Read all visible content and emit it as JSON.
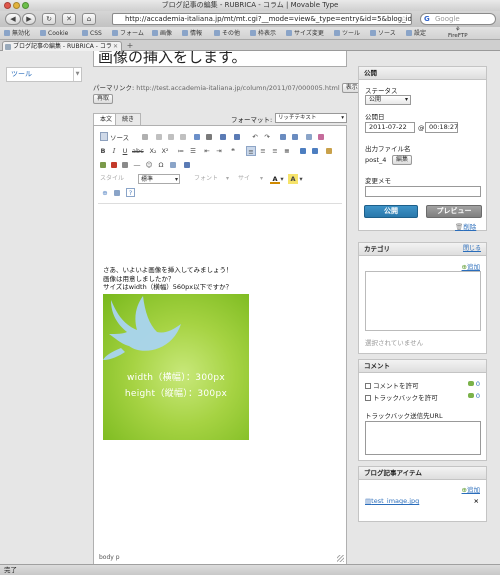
{
  "window": {
    "title": "ブログ記事の編集 - RUBRICA - コラム | Movable Type"
  },
  "browser": {
    "url": "http://accademia-italiana.jp/mt/mt.cgi?__mode=view&_type=entry&id=5&blog_id=2&s",
    "search_placeholder": "Google",
    "bookmarks": [
      "無効化",
      "Cookie",
      "CSS",
      "フォーム",
      "画像",
      "情報",
      "その他",
      "枠表示",
      "サイズ変更",
      "ツール",
      "ソース",
      "設定"
    ],
    "firefox_addon": "FireFTP",
    "tab_label": "ブログ記事の編集 - RUBRICA - コラ"
  },
  "sidebar": {
    "menu_item": "ツール"
  },
  "entry": {
    "title": "画像の挿入をします。",
    "permalink_label": "パーマリンク:",
    "permalink_url": "http://test.accademia-italiana.jp/column/2011/07/000005.html",
    "permalink_view": "表示",
    "permalink_change": "再取",
    "tabs": [
      "本文",
      "続き"
    ],
    "format_label": "フォーマット:",
    "format_value": "リッチテキスト"
  },
  "editor": {
    "source_label": "ソース",
    "style_label": "スタイル",
    "style_value": "標準",
    "font_label": "フォント",
    "size_label": "サイ",
    "body_lines": [
      "さあ、いよいよ画像を挿入してみましょう！",
      "画像は用意しましたか？",
      "サイズはwidth（横幅）560px以下ですか？"
    ],
    "image": {
      "caption_width": "width（横幅）：300px",
      "caption_height": "height（縦幅）：300px"
    },
    "status_path": "body  p"
  },
  "publish_panel": {
    "heading": "公開",
    "status_label": "ステータス",
    "status_value": "公開",
    "date_label": "公開日",
    "date_value": "2011-07-22",
    "at": "@",
    "time_value": "00:18:27",
    "filename_label": "出力ファイル名",
    "filename_value": "post_4",
    "filename_edit": "編集",
    "memo_label": "変更メモ",
    "publish_button": "公開",
    "preview_button": "プレビュー",
    "delete_link": "削除"
  },
  "category_panel": {
    "heading": "カテゴリ",
    "close_link": "閉じる",
    "add_link": "追加",
    "empty_text": "選択されていません"
  },
  "comment_panel": {
    "heading": "コメント",
    "allow_comments": "コメントを許可",
    "comment_count": "0",
    "allow_trackbacks": "トラックバックを許可",
    "trackback_count": "0",
    "trackback_url_label": "トラックバック送信先URL"
  },
  "assets_panel": {
    "heading": "ブログ記事アイテム",
    "add_link": "追加",
    "file_name": "test_image.jpg",
    "remove_icon": "×"
  },
  "statusbar": {
    "text": "完了"
  },
  "colors": {
    "publish_blue": "#2f82b8",
    "preview_gray": "#8c8c8c",
    "image_green": "#9ccd3c",
    "link_blue": "#2a6dbb"
  }
}
